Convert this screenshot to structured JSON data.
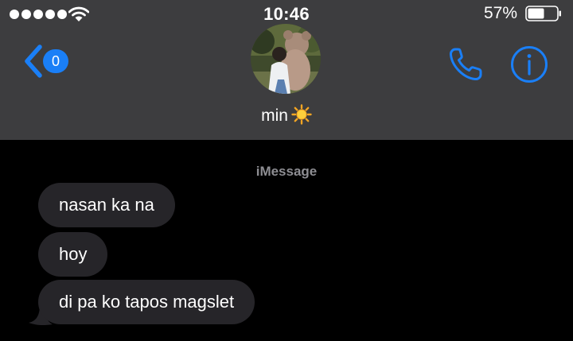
{
  "status_bar": {
    "time": "10:46",
    "battery_percent": "57%",
    "battery_level": 0.57,
    "signal_bars": 5
  },
  "header": {
    "unread_count": "0",
    "contact_name": "min",
    "accent_color": "#1a7ff7",
    "background_color": "#3d3d3f",
    "icons": [
      "back-chevron-icon",
      "phone-icon",
      "info-icon",
      "sun-emoji"
    ]
  },
  "conversation": {
    "service_label": "iMessage",
    "bubble_color": "#262529",
    "messages": [
      {
        "text": "nasan ka na",
        "direction": "incoming"
      },
      {
        "text": "hoy",
        "direction": "incoming"
      },
      {
        "text": "di pa ko tapos magslet",
        "direction": "incoming"
      }
    ]
  }
}
